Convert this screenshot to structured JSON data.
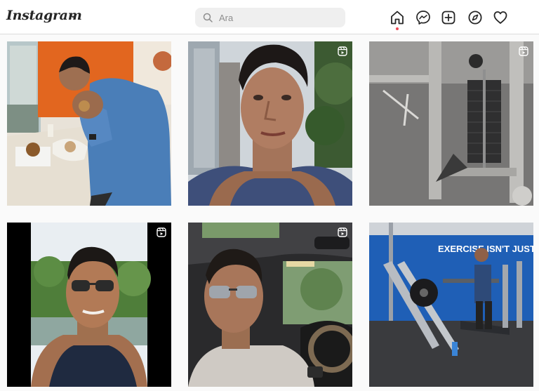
{
  "app": {
    "logo": "Instagram"
  },
  "search": {
    "placeholder": "Ara",
    "value": ""
  },
  "nav": [
    "home-icon",
    "messenger-icon",
    "new-post-icon",
    "explore-icon",
    "activity-heart-icon"
  ],
  "posts": [
    {
      "type": "photo",
      "subject": "man eating donut at shop counter"
    },
    {
      "type": "reel",
      "subject": "selfie in city street"
    },
    {
      "type": "reel",
      "subject": "gym cable machine weight stack"
    },
    {
      "type": "reel",
      "subject": "selfie with sunglasses by lake"
    },
    {
      "type": "reel",
      "subject": "selfie in car with sunroof"
    },
    {
      "type": "photo",
      "subject": "man on leg press in gym",
      "wall_text": "EXERCISE ISN'T JUST FOR MOOD"
    }
  ],
  "colors": {
    "accent_dot": "#ed4956",
    "icon": "#262626",
    "background": "#fafafa"
  }
}
